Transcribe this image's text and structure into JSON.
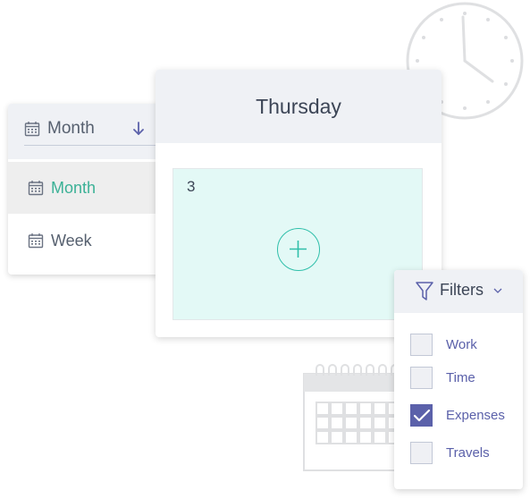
{
  "icons": {
    "clock": "clock-icon",
    "calendar": "calendar-icon",
    "view": "calendar-icon",
    "sort": "arrow-down-icon",
    "add": "plus-icon",
    "filter": "funnel-icon",
    "expand": "chevron-down-icon",
    "check": "checkmark-icon"
  },
  "colors": {
    "accent_green": "#3bb196",
    "accent_teal": "#2fbfaa",
    "accent_indigo": "#5b61aa",
    "header_bg": "#eff1f5",
    "cell_bg": "#e3f9f6"
  },
  "view_selector": {
    "selected_label": "Month",
    "options": [
      {
        "label": "Month",
        "active": true
      },
      {
        "label": "Week",
        "active": false
      }
    ]
  },
  "day_view": {
    "title": "Thursday",
    "date_number": "3"
  },
  "filters": {
    "title": "Filters",
    "items": [
      {
        "label": "Work",
        "checked": false
      },
      {
        "label": "Time",
        "checked": false
      },
      {
        "label": "Expenses",
        "checked": true
      },
      {
        "label": "Travels",
        "checked": false
      }
    ]
  }
}
